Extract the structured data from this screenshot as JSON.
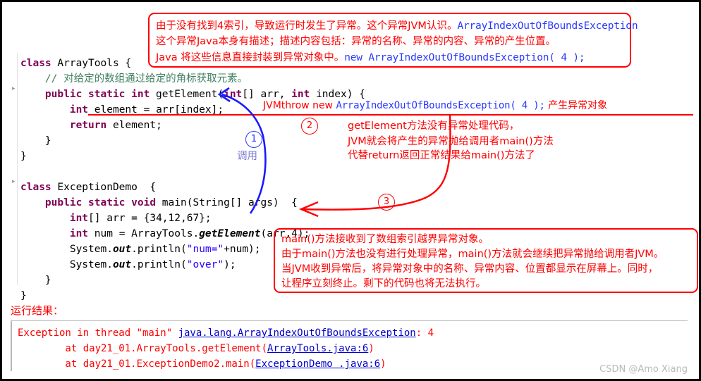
{
  "code": {
    "lines": [
      {
        "indent": 0,
        "segments": [
          {
            "t": "class",
            "c": "kw"
          },
          {
            "t": " ArrayTools {",
            "c": ""
          }
        ]
      },
      {
        "indent": 1,
        "segments": [
          {
            "t": "// 对给定的数组通过给定的角标获取元素。",
            "c": "cmt"
          }
        ]
      },
      {
        "indent": 1,
        "segments": [
          {
            "t": "public static int",
            "c": "kw"
          },
          {
            "t": " getElement(",
            "c": ""
          },
          {
            "t": "int",
            "c": "kw"
          },
          {
            "t": "[] arr, ",
            "c": ""
          },
          {
            "t": "int",
            "c": "kw"
          },
          {
            "t": " index) {",
            "c": ""
          }
        ]
      },
      {
        "indent": 2,
        "segments": [
          {
            "t": "int",
            "c": "kw"
          },
          {
            "t": " element = arr[index];",
            "c": ""
          }
        ]
      },
      {
        "indent": 2,
        "segments": [
          {
            "t": "return",
            "c": "kw"
          },
          {
            "t": " element;",
            "c": ""
          }
        ]
      },
      {
        "indent": 1,
        "segments": [
          {
            "t": "}",
            "c": ""
          }
        ]
      },
      {
        "indent": 0,
        "segments": [
          {
            "t": "}",
            "c": ""
          }
        ]
      },
      {
        "indent": 0,
        "segments": [
          {
            "t": "",
            "c": ""
          }
        ]
      },
      {
        "indent": 0,
        "segments": [
          {
            "t": "class",
            "c": "kw"
          },
          {
            "t": " ExceptionDemo  {",
            "c": ""
          }
        ]
      },
      {
        "indent": 1,
        "segments": [
          {
            "t": "public static void",
            "c": "kw"
          },
          {
            "t": " main(String[] args)  {",
            "c": ""
          }
        ]
      },
      {
        "indent": 2,
        "segments": [
          {
            "t": "int",
            "c": "kw"
          },
          {
            "t": "[] arr = {34,12,67};",
            "c": ""
          }
        ]
      },
      {
        "indent": 2,
        "segments": [
          {
            "t": "int",
            "c": "kw"
          },
          {
            "t": " num = ArrayTools.",
            "c": ""
          },
          {
            "t": "getElement",
            "c": "ital"
          },
          {
            "t": "(arr,4);",
            "c": ""
          }
        ]
      },
      {
        "indent": 2,
        "segments": [
          {
            "t": "System.",
            "c": ""
          },
          {
            "t": "out",
            "c": "ital"
          },
          {
            "t": ".println(",
            "c": ""
          },
          {
            "t": "\"num=\"",
            "c": "str"
          },
          {
            "t": "+num);",
            "c": ""
          }
        ]
      },
      {
        "indent": 2,
        "segments": [
          {
            "t": "System.",
            "c": ""
          },
          {
            "t": "out",
            "c": "ital"
          },
          {
            "t": ".println(",
            "c": ""
          },
          {
            "t": "\"over\"",
            "c": "str"
          },
          {
            "t": ");",
            "c": ""
          }
        ]
      },
      {
        "indent": 1,
        "segments": [
          {
            "t": "}",
            "c": ""
          }
        ]
      },
      {
        "indent": 0,
        "segments": [
          {
            "t": "}",
            "c": ""
          }
        ]
      }
    ]
  },
  "annotations": {
    "top_box": {
      "line1_red_a": "由于没有找到4索引，导致运行时发生了异常。这个异常",
      "line1_red_b": "JVM",
      "line1_red_c": "认识。",
      "line1_blue": "ArrayIndexOutOfBoundsException",
      "line2": "这个异常Java本身有描述；描述内容包括：异常的名称、异常的内容、异常的产生位置。",
      "line3_red": "Java 将这些信息直接封装到异常对象中。",
      "line3_blue": "new ArrayIndexOutOfBoundsException( 4 );"
    },
    "throw_line": {
      "prefix_red": "JVM",
      "mid_red": "throw new ",
      "blue": "ArrayIndexOutOfBoundsException( 4 );",
      "suffix_red": " 产生异常对象"
    },
    "right_note": {
      "line1": "getElement方法没有异常处理代码，",
      "line2": "JVM就会将产生的异常抛给调用者main()方法",
      "line3": "代替return返回正常结果给main()方法了"
    },
    "bottom_box": {
      "line1": "main()方法接收到了数组索引越界异常对象。",
      "line2": "由于main()方法也没有进行处理异常，main()方法就会继续把异常抛给调用者JVM。",
      "line3": "当JVM收到异常后，将异常对象中的名称、异常内容、位置都显示在屏幕上。同时，",
      "line4": "让程序立刻终止。剩下的代码也将无法执行。"
    },
    "markers": {
      "one": "1",
      "two": "2",
      "three": "3",
      "call_label": "调用"
    }
  },
  "result": {
    "label": "运行结果：",
    "line1_a": "Exception in thread \"main\" ",
    "line1_link": "java.lang.ArrayIndexOutOfBoundsException",
    "line1_b": ": 4",
    "line2_a": "        at day21_01.ArrayTools.getElement(",
    "line2_link": "ArrayTools.java:6",
    "line2_b": ")",
    "line3_a": "        at day21_01.ExceptionDemo2.main(",
    "line3_link": "ExceptionDemo .java:6",
    "line3_b": ")"
  },
  "watermark": "CSDN @Amo Xiang",
  "colors": {
    "annotation_red": "#ff0000",
    "code_blue": "#2a38ff",
    "keyword": "#7f0055",
    "comment": "#3f7f5f",
    "string": "#2a00ff",
    "link": "#0000cc"
  }
}
